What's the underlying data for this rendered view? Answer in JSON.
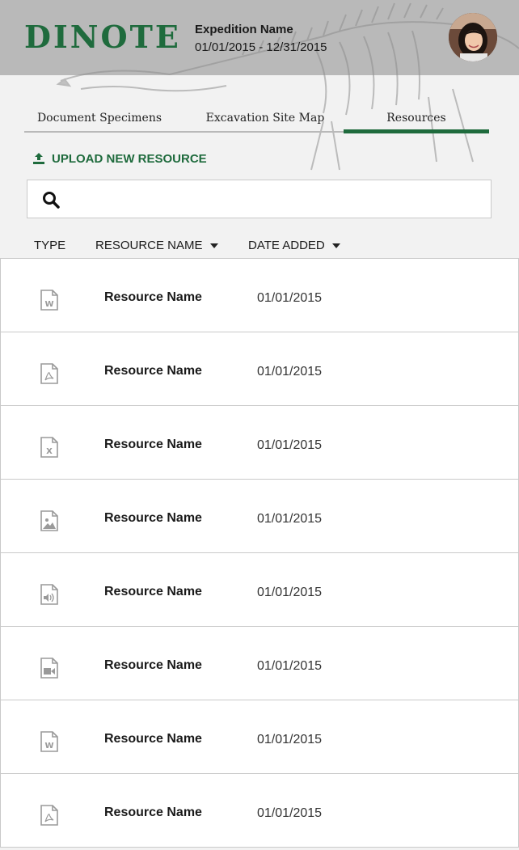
{
  "header": {
    "logo_text": "DINOTE",
    "expedition_name": "Expedition Name",
    "expedition_dates": "01/01/2015 - 12/31/2015"
  },
  "tabs": [
    {
      "label": "Document Specimens",
      "active": false
    },
    {
      "label": "Excavation Site Map",
      "active": false
    },
    {
      "label": "Resources",
      "active": true
    }
  ],
  "upload_label": "UPLOAD NEW RESOURCE",
  "search": {
    "placeholder": "",
    "value": ""
  },
  "columns": {
    "type": "TYPE",
    "resource_name": "RESOURCE NAME",
    "date_added": "DATE ADDED"
  },
  "resources": [
    {
      "type": "word-doc",
      "name": "Resource Name",
      "date": "01/01/2015"
    },
    {
      "type": "pdf",
      "name": "Resource Name",
      "date": "01/01/2015"
    },
    {
      "type": "excel",
      "name": "Resource Name",
      "date": "01/01/2015"
    },
    {
      "type": "image",
      "name": "Resource Name",
      "date": "01/01/2015"
    },
    {
      "type": "audio",
      "name": "Resource Name",
      "date": "01/01/2015"
    },
    {
      "type": "video",
      "name": "Resource Name",
      "date": "01/01/2015"
    },
    {
      "type": "word-doc",
      "name": "Resource Name",
      "date": "01/01/2015"
    },
    {
      "type": "pdf",
      "name": "Resource Name",
      "date": "01/01/2015"
    }
  ],
  "colors": {
    "brand_green": "#1f6b3d",
    "header_gray": "#b9b9b9",
    "icon_gray": "#9a9a9a"
  }
}
